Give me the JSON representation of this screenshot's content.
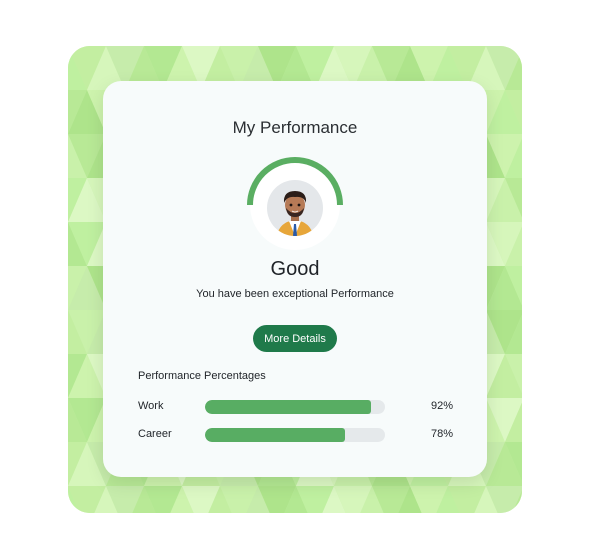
{
  "card": {
    "title": "My Performance",
    "status": "Good",
    "subtitle": "You have been exceptional Performance",
    "button_label": "More Details"
  },
  "performance": {
    "section_label": "Performance Percentages",
    "items": [
      {
        "label": "Work",
        "value_text": "92%",
        "fraction": 0.92
      },
      {
        "label": "Career",
        "value_text": "78%",
        "fraction": 0.78
      }
    ]
  },
  "avatar": {
    "icon": "user-avatar-icon"
  },
  "colors": {
    "accent_green": "#58ad63",
    "button_green": "#1f7a4a",
    "ring_green": "#5aae62",
    "track_gray": "#e5e9eb",
    "frame_green": "#c8f0a8"
  }
}
